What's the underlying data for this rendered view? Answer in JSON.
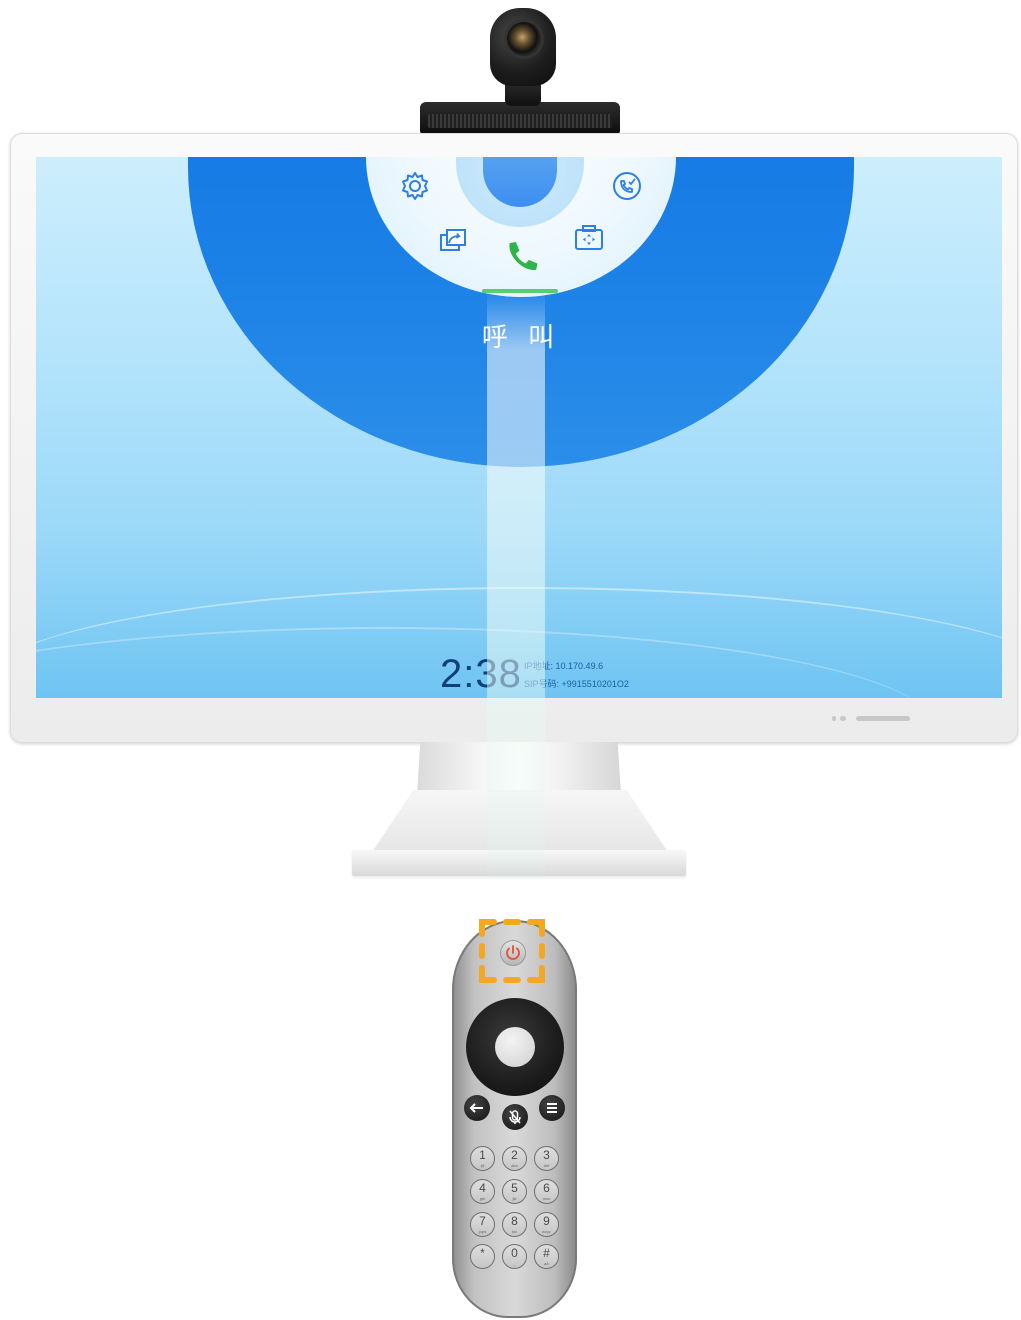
{
  "screen": {
    "call_label": "呼 叫",
    "clock": "2:38",
    "ip_label": "IP地址:",
    "ip_value": "10.170.49.6",
    "sip_label": "SIP号码:",
    "sip_value": "+9915510201O2"
  },
  "menu_icons": [
    "gear-icon",
    "call-history-icon",
    "screen-share-icon",
    "phone-icon",
    "camera-control-icon"
  ],
  "remote": {
    "keys": [
      {
        "digit": "1",
        "sub": "@"
      },
      {
        "digit": "2",
        "sub": "abc"
      },
      {
        "digit": "3",
        "sub": "def"
      },
      {
        "digit": "4",
        "sub": "ghi"
      },
      {
        "digit": "5",
        "sub": "jkl"
      },
      {
        "digit": "6",
        "sub": "mno"
      },
      {
        "digit": "7",
        "sub": "pqrs"
      },
      {
        "digit": "8",
        "sub": "tuv"
      },
      {
        "digit": "9",
        "sub": "wxyz"
      },
      {
        "digit": "*",
        "sub": ""
      },
      {
        "digit": "0",
        "sub": "_"
      },
      {
        "digit": "#",
        "sub": "aA"
      }
    ]
  },
  "colors": {
    "screen_blue": "#1a7fe6",
    "call_green": "#2fb34a",
    "highlight_orange": "#f5a623",
    "power_red": "#e0503a"
  }
}
